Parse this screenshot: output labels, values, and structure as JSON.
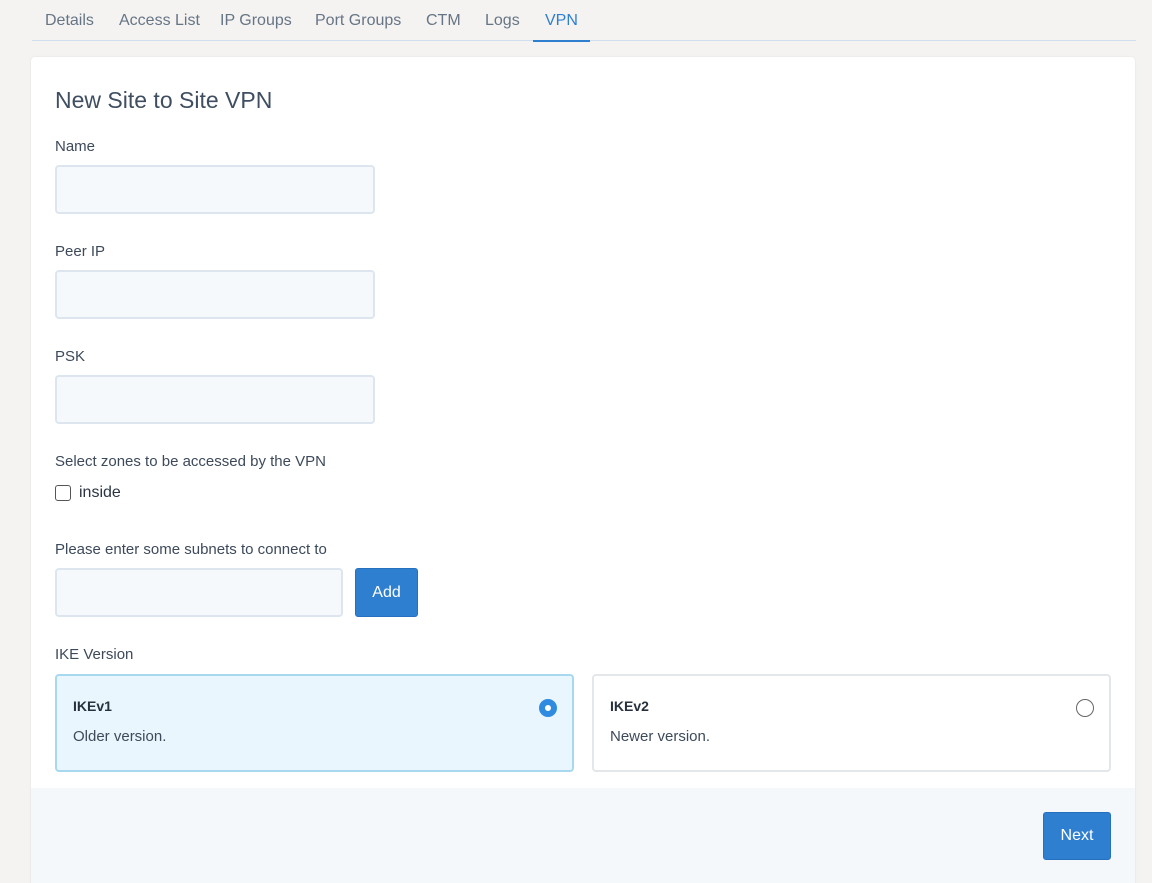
{
  "tabs": [
    {
      "label": "Details"
    },
    {
      "label": "Access List"
    },
    {
      "label": "IP Groups"
    },
    {
      "label": "Port Groups"
    },
    {
      "label": "CTM"
    },
    {
      "label": "Logs"
    },
    {
      "label": "VPN",
      "active": true
    }
  ],
  "form": {
    "title": "New Site to Site VPN",
    "name_label": "Name",
    "name_value": "",
    "peer_ip_label": "Peer IP",
    "peer_ip_value": "",
    "psk_label": "PSK",
    "psk_value": "",
    "zones_label": "Select zones to be accessed by the VPN",
    "zones": [
      {
        "label": "inside",
        "checked": false
      }
    ],
    "subnets_label": "Please enter some subnets to connect to",
    "subnets_value": "",
    "add_label": "Add",
    "ike_label": "IKE Version",
    "ike_options": [
      {
        "name": "IKEv1",
        "description": "Older version.",
        "selected": true
      },
      {
        "name": "IKEv2",
        "description": "Newer version.",
        "selected": false
      }
    ],
    "next_label": "Next"
  },
  "colors": {
    "accent": "#2f7fd1",
    "selected_card_bg": "#eaf6fd",
    "selected_card_border": "#a8d8f0",
    "page_bg": "#f4f3f1"
  },
  "icons": {
    "radio_selected": "radio-selected-icon",
    "radio_unselected": "radio-unselected-icon",
    "checkbox": "checkbox-icon"
  }
}
